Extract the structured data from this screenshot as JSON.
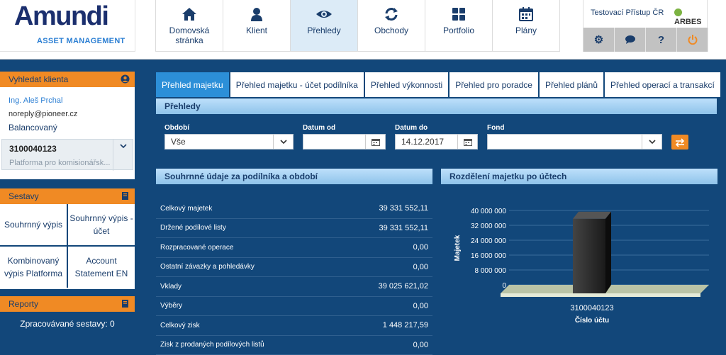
{
  "brand": {
    "name": "Amundi",
    "tagline": "ASSET MANAGEMENT"
  },
  "nav": [
    {
      "label": "Domovská stránka",
      "icon": "home-icon",
      "active": false
    },
    {
      "label": "Klient",
      "icon": "user-icon",
      "active": false
    },
    {
      "label": "Přehledy",
      "icon": "eye-icon",
      "active": true
    },
    {
      "label": "Obchody",
      "icon": "refresh-icon",
      "active": false
    },
    {
      "label": "Portfolio",
      "icon": "grid-icon",
      "active": false
    },
    {
      "label": "Plány",
      "icon": "calendar-icon",
      "active": false
    }
  ],
  "user": {
    "access": "Testovací Přístup ČR",
    "vendor": "ARBES"
  },
  "tools": [
    {
      "icon": "gear-icon",
      "glyph": "⚙"
    },
    {
      "icon": "chat-icon",
      "glyph": "●"
    },
    {
      "icon": "help-icon",
      "glyph": "?"
    },
    {
      "icon": "power-icon",
      "glyph": "⏻"
    }
  ],
  "sidebar": {
    "find_client": {
      "title": "Vyhledat klienta",
      "name": "Ing. Aleš Prchal",
      "email": "noreply@pioneer.cz",
      "profile": "Balancovaný",
      "account": {
        "number": "3100040123",
        "platform": "Platforma pro komisionářsk..."
      }
    },
    "reports": {
      "title": "Sestavy",
      "items": [
        "Souhrnný výpis",
        "Souhrnný výpis - účet",
        "Kombinovaný výpis Platforma",
        "Account Statement EN"
      ]
    },
    "report": {
      "title": "Reporty",
      "processing": "Zpracovávané sestavy: 0"
    }
  },
  "tabs": [
    {
      "label": "Přehled majetku",
      "active": true
    },
    {
      "label": "Přehled majetku - účet podílníka",
      "active": false
    },
    {
      "label": "Přehled výkonnosti",
      "active": false
    },
    {
      "label": "Přehled pro poradce",
      "active": false
    },
    {
      "label": "Přehled plánů",
      "active": false
    },
    {
      "label": "Přehled operací a transakcí",
      "active": false
    }
  ],
  "filter": {
    "title": "Přehledy",
    "period_label": "Období",
    "period_value": "Vše",
    "date_from_label": "Datum od",
    "date_from_value": "",
    "date_to_label": "Datum do",
    "date_to_value": "14.12.2017",
    "fund_label": "Fond",
    "fund_value": ""
  },
  "summary": {
    "title": "Souhrnné údaje za podílníka a období",
    "rows": [
      {
        "label": "Celkový majetek",
        "value": "39 331 552,11"
      },
      {
        "label": "Držené podílové listy",
        "value": "39 331 552,11"
      },
      {
        "label": "Rozpracované operace",
        "value": "0,00"
      },
      {
        "label": "Ostatní závazky a pohledávky",
        "value": "0,00"
      },
      {
        "label": "Vklady",
        "value": "39 025 621,02"
      },
      {
        "label": "Výběry",
        "value": "0,00"
      },
      {
        "label": "Celkový zisk",
        "value": "1 448 217,59"
      },
      {
        "label": "Zisk z prodaných podílových listů",
        "value": "0,00"
      }
    ]
  },
  "chart_data": {
    "type": "bar",
    "title": "Rozdělení majetku po účtech",
    "xlabel": "Číslo účtu",
    "ylabel": "Majetek",
    "categories": [
      "3100040123"
    ],
    "values": [
      39331552.11
    ],
    "ylim": [
      0,
      40000000
    ],
    "yticks": [
      0,
      8000000,
      16000000,
      24000000,
      32000000,
      40000000
    ],
    "ytick_labels": [
      "0",
      "8 000 000",
      "16 000 000",
      "24 000 000",
      "32 000 000",
      "40 000 000"
    ],
    "grid": true,
    "bar_color": "#1a1a1a",
    "floor_color": "#b9c3a6"
  },
  "colors": {
    "accent": "#f08a24",
    "primary": "#12477a",
    "tab_active": "#2c8fd8"
  }
}
